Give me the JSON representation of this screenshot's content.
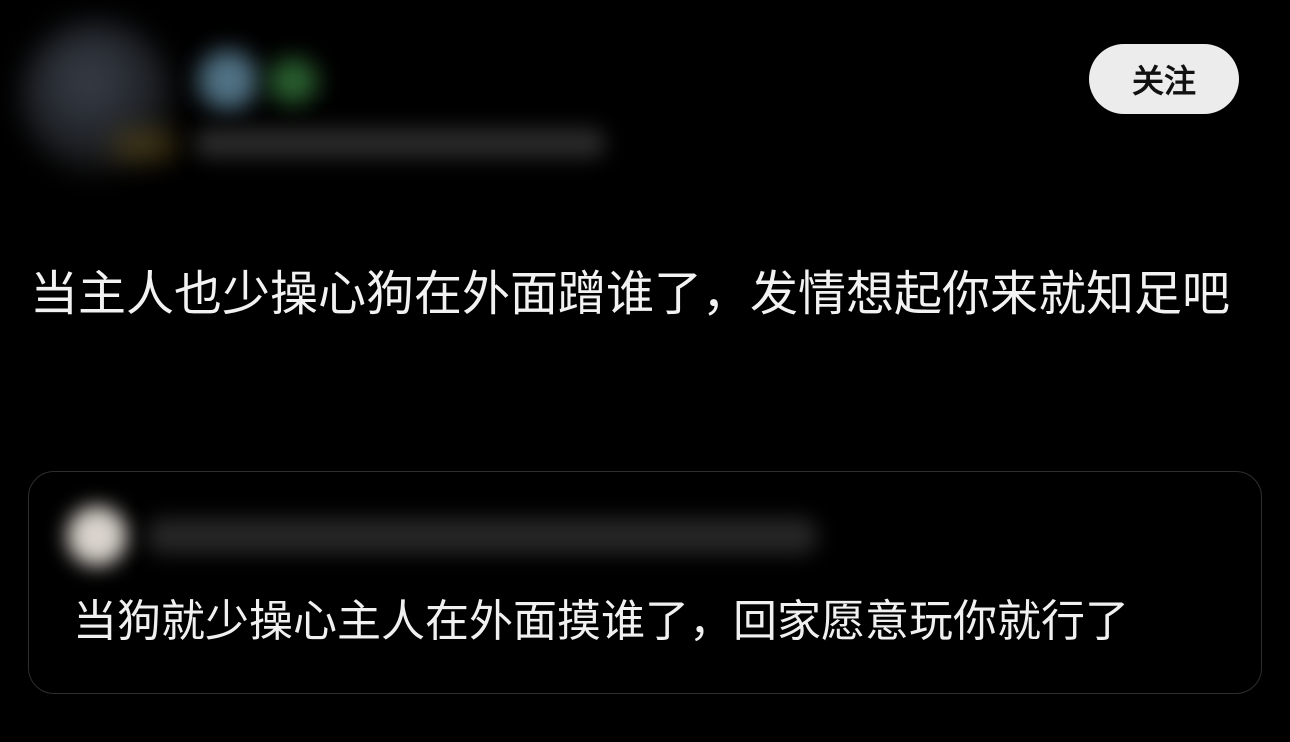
{
  "post": {
    "author_avatar": "blurred-avatar",
    "follow_label": "关注",
    "text": "当主人也少操心狗在外面蹭谁了，发情想起你来就知足吧"
  },
  "quoted": {
    "author_avatar": "blurred-avatar",
    "text": "当狗就少操心主人在外面摸谁了，回家愿意玩你就行了"
  },
  "colors": {
    "background": "#000000",
    "follow_button_bg": "#ececec",
    "text": "#f2f2f2",
    "card_border": "#2e2e2e"
  }
}
